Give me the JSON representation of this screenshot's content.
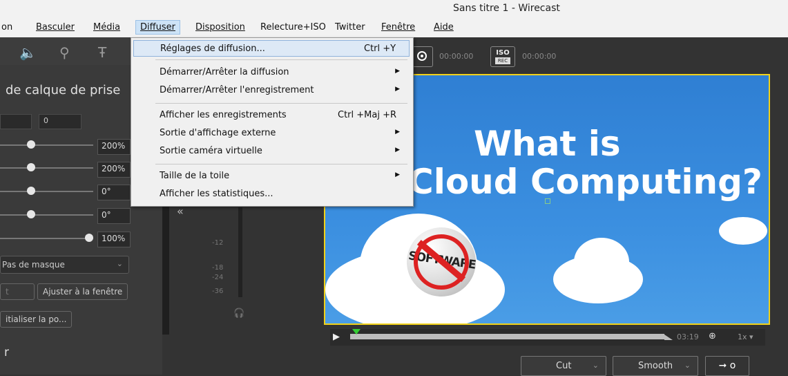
{
  "window": {
    "title": "Sans titre 1 - Wirecast"
  },
  "menubar": {
    "items": [
      {
        "label": "on"
      },
      {
        "label": "Basculer"
      },
      {
        "label": "Média"
      },
      {
        "label": "Diffuser"
      },
      {
        "label": "Disposition"
      },
      {
        "label": "Relecture+ISO"
      },
      {
        "label": "Twitter"
      },
      {
        "label": "Fenêtre"
      },
      {
        "label": "Aide"
      }
    ]
  },
  "diffuser_menu": {
    "items": [
      {
        "label": "Réglages de diffusion...",
        "shortcut": "Ctrl +Y",
        "submenu": false,
        "highlighted": true
      },
      {
        "label": "Démarrer/Arrêter la diffusion",
        "shortcut": "",
        "submenu": true
      },
      {
        "label": "Démarrer/Arrêter l'enregistrement",
        "shortcut": "",
        "submenu": true
      },
      {
        "label": "Afficher les enregistrements",
        "shortcut": "Ctrl +Maj +R",
        "submenu": false
      },
      {
        "label": "Sortie d'affichage externe",
        "shortcut": "",
        "submenu": true
      },
      {
        "label": "Sortie caméra virtuelle",
        "shortcut": "",
        "submenu": true
      },
      {
        "label": "Taille de la toile",
        "shortcut": "",
        "submenu": true
      },
      {
        "label": "Afficher les statistiques...",
        "shortcut": "",
        "submenu": false
      }
    ]
  },
  "left_panel": {
    "heading": "de calque de prise",
    "offset_value": "0",
    "sliders": [
      {
        "value": "200%",
        "level": 0.27
      },
      {
        "value": "200%",
        "level": 0.27
      },
      {
        "value": "0°",
        "level": 0.27
      },
      {
        "value": "0°",
        "level": 0.27
      },
      {
        "value": "100%",
        "level": 1.0
      }
    ],
    "mask_select": "Pas de masque",
    "btn_fit_left": "t",
    "btn_fit_window": "Ajuster à la fenêtre",
    "btn_reset": "itialiser la po...",
    "bottom_label": "r"
  },
  "audio": {
    "db_labels": [
      "-12",
      "-18",
      "-24",
      "-36"
    ]
  },
  "toolbar": {
    "record_time": "00:00:00",
    "iso_label_top": "ISO",
    "iso_label_bottom": "REC",
    "iso_time": "00:00:00"
  },
  "preview": {
    "line1": "What is",
    "line2": "Cloud Computing?",
    "badge_word": "SOFTWARE"
  },
  "timeline": {
    "duration": "03:19",
    "speed": "1x",
    "progress": 0.0
  },
  "transitions": {
    "cut_label": "Cut",
    "smooth_label": "Smooth",
    "go_label": "➞ o"
  }
}
